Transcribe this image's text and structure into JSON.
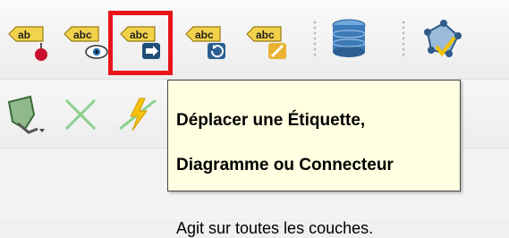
{
  "toolbar": {
    "label_tools": [
      {
        "name": "ab",
        "label": "ab"
      },
      {
        "name": "abc-visibility",
        "label": "abc"
      },
      {
        "name": "abc-move",
        "label": "abc"
      },
      {
        "name": "abc-rotate",
        "label": "abc"
      },
      {
        "name": "abc-edit",
        "label": "abc"
      }
    ]
  },
  "tooltip": {
    "title_line1": "Déplacer une Étiquette,",
    "title_line2": "Diagramme ou Connecteur",
    "body": "Agit sur toutes les couches."
  },
  "colors": {
    "highlight": "#e8141c",
    "tooltip_bg": "#ffffe1",
    "label_yellow": "#f2d24a"
  }
}
